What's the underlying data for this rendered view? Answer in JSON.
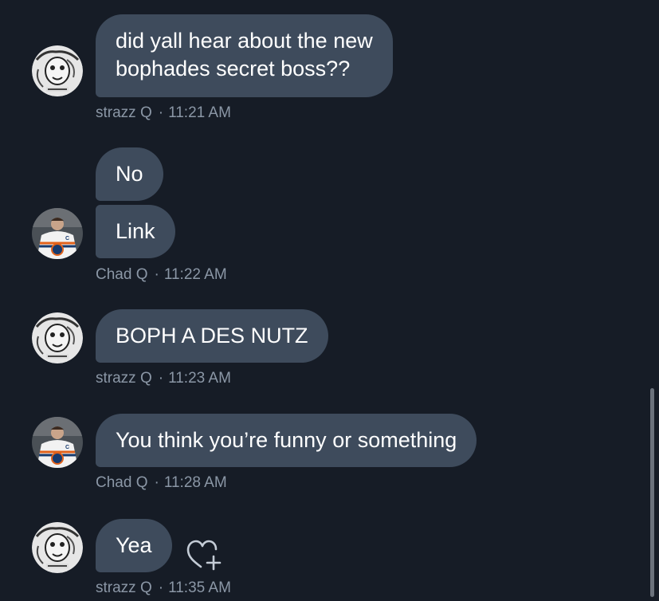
{
  "conversation": {
    "messages": [
      {
        "sender": "strazz Q",
        "time": "11:21 AM",
        "avatar_icon": "cartoon-face-avatar",
        "lines": [
          "did yall hear about the new",
          "bophades secret boss??"
        ]
      },
      {
        "sender": "Chad Q",
        "time": "11:22 AM",
        "avatar_icon": "hockey-player-avatar",
        "bubbles": [
          "No",
          "Link"
        ]
      },
      {
        "sender": "strazz Q",
        "time": "11:23 AM",
        "avatar_icon": "cartoon-face-avatar",
        "text": "BOPH A DES NUTZ"
      },
      {
        "sender": "Chad Q",
        "time": "11:28 AM",
        "avatar_icon": "hockey-player-avatar",
        "text": "You think you’re funny or something"
      },
      {
        "sender": "strazz Q",
        "time": "11:35 AM",
        "avatar_icon": "cartoon-face-avatar",
        "text": "Yea",
        "reaction_icon": "heart-add-icon"
      }
    ],
    "separator": "·",
    "colors": {
      "background": "#161c26",
      "bubble": "#3e4b5c",
      "meta_text": "#8b97a6"
    }
  }
}
